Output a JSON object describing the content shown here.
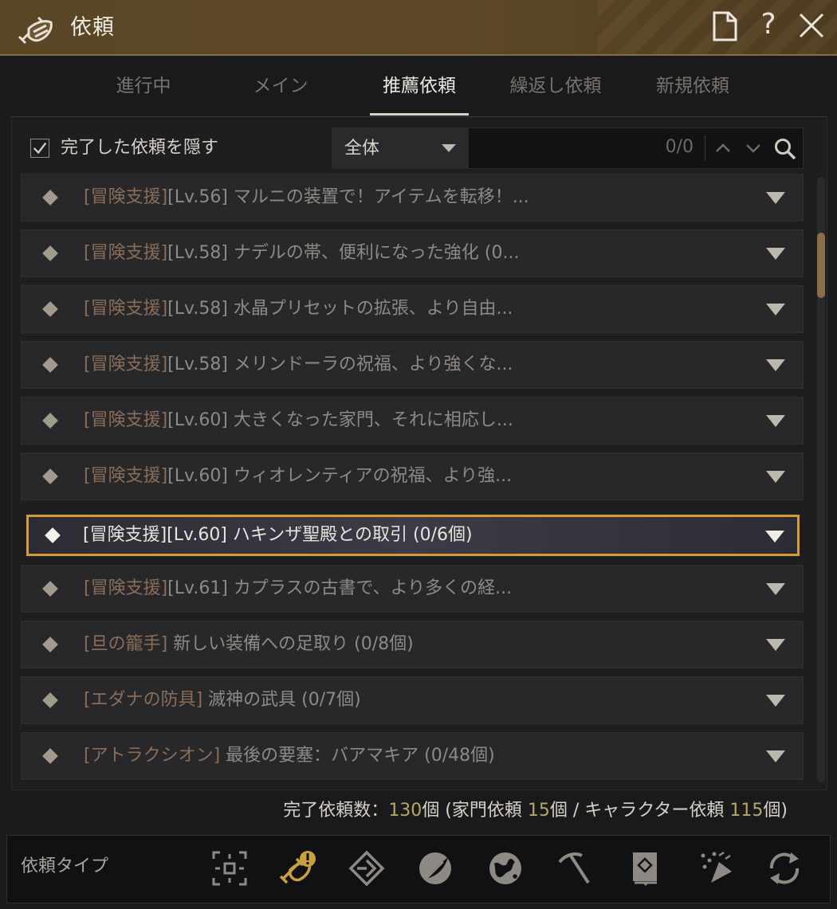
{
  "window": {
    "title": "依頼",
    "help_label": "?"
  },
  "tabs": [
    {
      "label": "進行中",
      "active": false
    },
    {
      "label": "メイン",
      "active": false
    },
    {
      "label": "推薦依頼",
      "active": true
    },
    {
      "label": "繰返し依頼",
      "active": false
    },
    {
      "label": "新規依頼",
      "active": false
    }
  ],
  "filter": {
    "hide_completed_label": "完了した依頼を隠す",
    "hide_completed_checked": true,
    "category_selected": "全体",
    "search_count": "0/0"
  },
  "quests": [
    {
      "tag": "[冒険支援]",
      "title": "[Lv.56] マルニの装置で！アイテムを転移！...",
      "selected": false
    },
    {
      "tag": "[冒険支援]",
      "title": "[Lv.58] ナデルの帯、便利になった強化 (0...",
      "selected": false
    },
    {
      "tag": "[冒険支援]",
      "title": "[Lv.58] 水晶プリセットの拡張、より自由...",
      "selected": false
    },
    {
      "tag": "[冒険支援]",
      "title": "[Lv.58] メリンドーラの祝福、より強くな...",
      "selected": false
    },
    {
      "tag": "[冒険支援]",
      "title": "[Lv.60] 大きくなった家門、それに相応し...",
      "selected": false
    },
    {
      "tag": "[冒険支援]",
      "title": "[Lv.60] ウィオレンティアの祝福、より強...",
      "selected": false
    },
    {
      "tag": "[冒険支援]",
      "title": "[Lv.60] ハキンザ聖殿との取引 (0/6個)",
      "selected": true
    },
    {
      "tag": "[冒険支援]",
      "title": "[Lv.61] カプラスの古書で、より多くの経...",
      "selected": false
    },
    {
      "tag": "[旦の籠手]",
      "title": " 新しい装備への足取り (0/8個)",
      "selected": false
    },
    {
      "tag": "[エダナの防具]",
      "title": " 滅神の武具 (0/7個)",
      "selected": false
    },
    {
      "tag": "[アトラクシオン]",
      "title": " 最後の要塞：バアマキア (0/48個)",
      "selected": false
    }
  ],
  "summary": {
    "prefix": "完了依頼数：",
    "total": "130",
    "part1": "個 (家門依頼 ",
    "family": "15",
    "part2": "個 / キャラクター依頼 ",
    "character": "115",
    "suffix": "個)"
  },
  "footer": {
    "label": "依頼タイプ",
    "types": [
      {
        "icon": "all-types-icon",
        "active": false
      },
      {
        "icon": "recommended-scroll-icon",
        "active": true
      },
      {
        "icon": "compass-diamond-icon",
        "active": false
      },
      {
        "icon": "feather-icon",
        "active": false
      },
      {
        "icon": "globe-icon",
        "active": false
      },
      {
        "icon": "pickaxe-icon",
        "active": false
      },
      {
        "icon": "book-icon",
        "active": false
      },
      {
        "icon": "celebration-icon",
        "active": false
      },
      {
        "icon": "repeat-icon",
        "active": false
      }
    ]
  },
  "colors": {
    "accent": "#d79a36",
    "title_bar": "#5a4525",
    "summary_number": "#b5a76a",
    "active_icon": "#c9a23d"
  }
}
